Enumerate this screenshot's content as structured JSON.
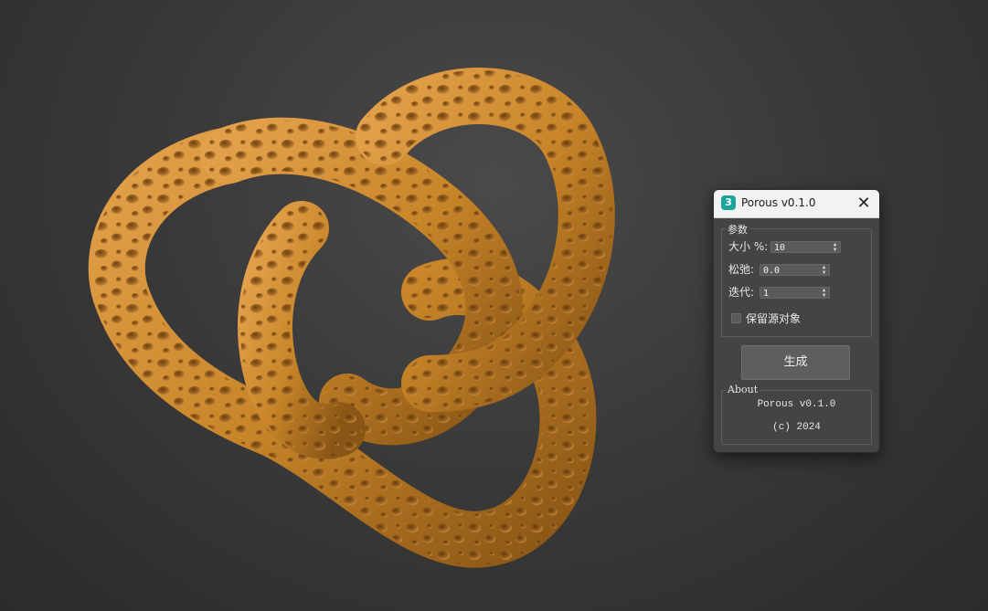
{
  "viewport": {
    "model_color": "#d18a2e",
    "background": "#3a3a3a"
  },
  "dialog": {
    "app_icon": "3",
    "title": "Porous v0.1.0",
    "close_glyph": "✕",
    "params_group": {
      "label": "参数",
      "size_label": "大小 %:",
      "size_value": "10",
      "relax_label": "松弛:",
      "relax_value": "0.0",
      "iter_label": "迭代:",
      "iter_value": "1",
      "keep_source_label": "保留源对象",
      "keep_source_checked": false
    },
    "generate_button": "生成",
    "about_group": {
      "label": "About",
      "line1": "Porous v0.1.0",
      "line2": "(c) 2024"
    }
  }
}
